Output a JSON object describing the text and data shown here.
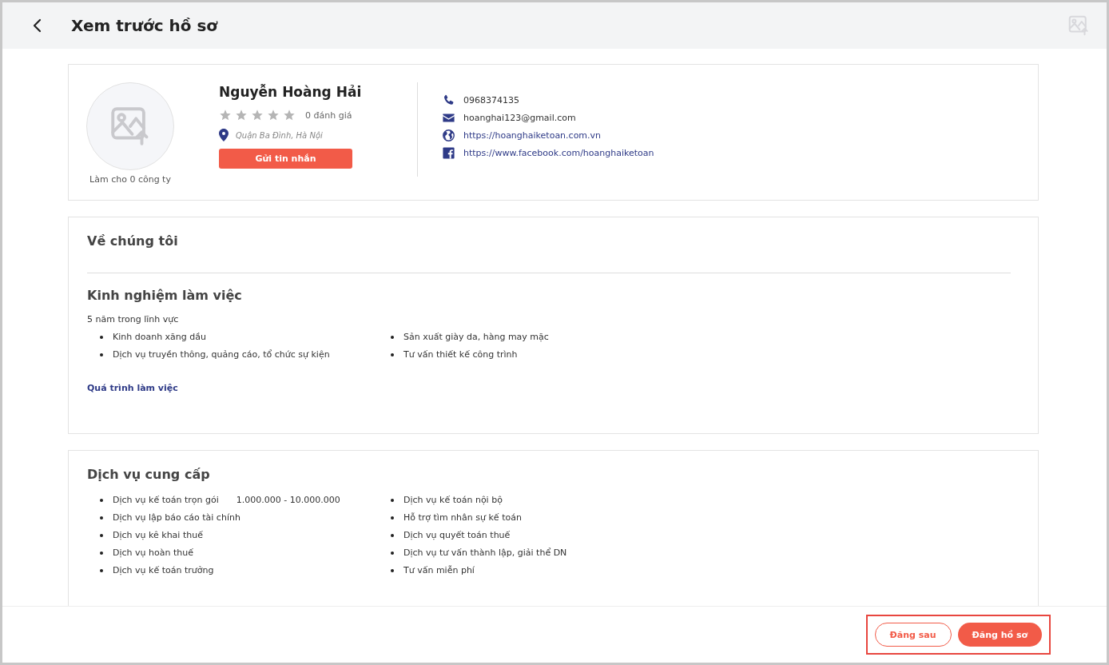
{
  "header": {
    "title": "Xem trước hồ sơ"
  },
  "profile": {
    "name": "Nguyễn Hoàng Hải",
    "stars": 0,
    "rating_text": "0 đánh giá",
    "location": "Quận Ba Đình, Hà Nội",
    "message_button": "Gửi tin nhắn",
    "companies": "Làm cho 0 công ty",
    "contacts": [
      {
        "kind": "phone",
        "text": "0968374135"
      },
      {
        "kind": "email",
        "text": "hoanghai123@gmail.com"
      },
      {
        "kind": "web",
        "text": "https://hoanghaiketoan.com.vn"
      },
      {
        "kind": "facebook",
        "text": "https://www.facebook.com/hoanghaiketoan"
      }
    ]
  },
  "about": {
    "title": "Về chúng tôi",
    "experience_title": "Kinh nghiệm làm việc",
    "years": "5 năm trong lĩnh vực",
    "fields": [
      [
        "Kinh doanh xăng dầu",
        "Dịch vụ truyền thông, quảng cáo, tổ chức sự kiện"
      ],
      [
        "Sản xuất giày da, hàng may mặc",
        "Tư vấn thiết kế công trình"
      ]
    ],
    "history_link": "Quá trình làm việc"
  },
  "services": {
    "title": "Dịch vụ cung cấp",
    "columns": [
      [
        {
          "name": "Dịch vụ kế toán trọn gói",
          "price": "1.000.000 - 10.000.000"
        },
        {
          "name": "Dịch vụ lập báo cáo tài chính"
        },
        {
          "name": "Dịch vụ kê khai thuế"
        },
        {
          "name": "Dịch vụ hoàn thuế"
        },
        {
          "name": "Dịch vụ kế toán trưởng"
        }
      ],
      [
        {
          "name": "Dịch vụ kế toán nội bộ"
        },
        {
          "name": "Hỗ trợ tìm nhân sự kế toán"
        },
        {
          "name": "Dịch vụ quyết toán thuế"
        },
        {
          "name": "Dịch vụ tư vấn thành lập, giải thể DN"
        },
        {
          "name": "Tư vấn miễn phí"
        }
      ]
    ]
  },
  "footer": {
    "later_button": "Đăng sau",
    "publish_button": "Đăng hồ sơ"
  }
}
